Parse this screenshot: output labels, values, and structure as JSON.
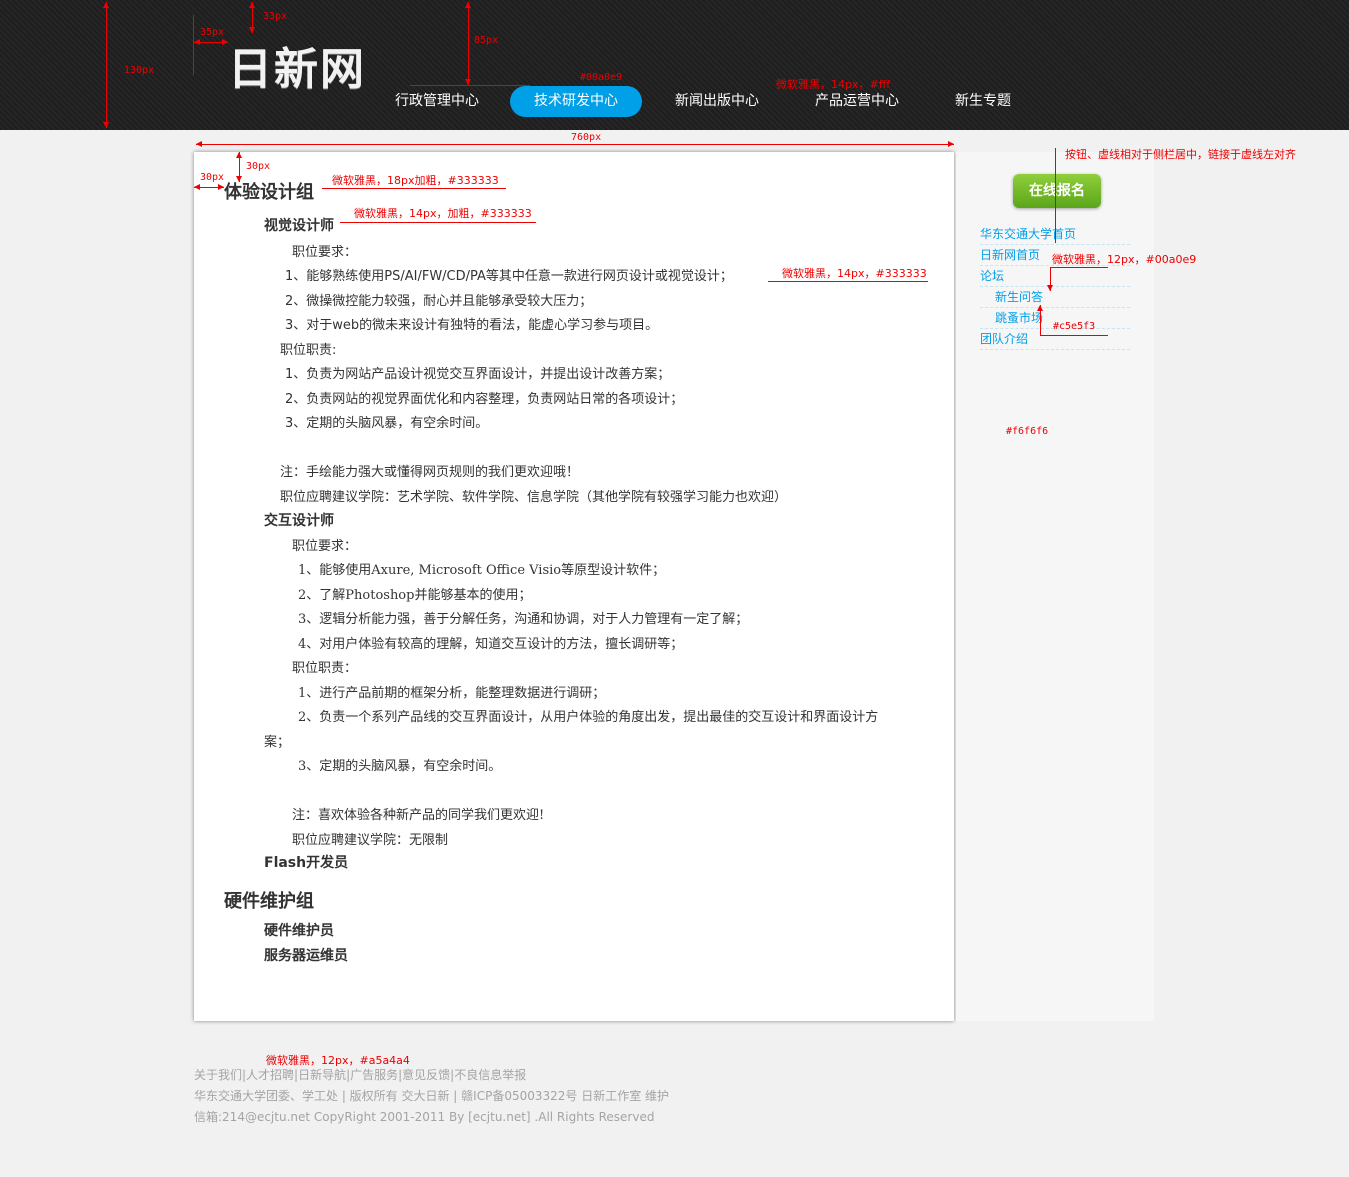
{
  "header": {
    "logo": "日新网",
    "nav": [
      {
        "label": "行政管理中心",
        "active": false
      },
      {
        "label": "技术研发中心",
        "active": true
      },
      {
        "label": "新闻出版中心",
        "active": false
      },
      {
        "label": "产品运营中心",
        "active": false
      },
      {
        "label": "新生专题",
        "active": false
      }
    ]
  },
  "main": {
    "group1_title": "体验设计组",
    "visual": {
      "title": "视觉设计师",
      "req_label": "职位要求：",
      "req": [
        "1、能够熟练使用PS/AI/FW/CD/PA等其中任意一款进行网页设计或视觉设计；",
        "2、微操微控能力较强，耐心并且能够承受较大压力；",
        "3、对于web的微未来设计有独特的看法，能虚心学习参与项目。"
      ],
      "duty_label": "职位职责:",
      "duty": [
        "1、负责为网站产品设计视觉交互界面设计，并提出设计改善方案；",
        "2、负责网站的视觉界面优化和内容整理，负责网站日常的各项设计；",
        "3、定期的头脑风暴，有空余时间。"
      ],
      "note": "注：手绘能力强大或懂得网页规则的我们更欢迎哦！",
      "college": "职位应聘建议学院：艺术学院、软件学院、信息学院（其他学院有较强学习能力也欢迎）"
    },
    "interaction": {
      "title": "交互设计师",
      "req_label": "职位要求：",
      "req": [
        "1、能够使用Axure, Microsoft Office Visio等原型设计软件；",
        "2、了解Photoshop并能够基本的使用；",
        "3、逻辑分析能力强，善于分解任务，沟通和协调，对于人力管理有一定了解；",
        "4、对用户体验有较高的理解，知道交互设计的方法，擅长调研等；"
      ],
      "duty_label": "职位职责：",
      "duty": [
        "1、进行产品前期的框架分析，能整理数据进行调研；",
        "2、负责一个系列产品线的交互界面设计，从用户体验的角度出发，提出最佳的交互设计和界面设计方",
        "案；",
        "3、定期的头脑风暴，有空余时间。"
      ],
      "note": "注：喜欢体验各种新产品的同学我们更欢迎!",
      "college": "职位应聘建议学院：无限制"
    },
    "flash_title": "Flash开发员",
    "group2_title": "硬件维护组",
    "hw1": "硬件维护员",
    "hw2": "服务器运维员"
  },
  "sidebar": {
    "apply_button": "在线报名",
    "links": [
      "华东交通大学首页",
      "日新网首页",
      "论坛",
      "新生问答",
      "跳蚤市场",
      "团队介绍"
    ]
  },
  "footer": {
    "links": "关于我们|人才招聘|日新导航|广告服务|意见反馈|不良信息举报",
    "line2": "华东交通大学团委、学工处 | 版权所有 交大日新 | 赣ICP备05003322号 日新工作室 维护",
    "line3": "信箱:214@ecjtu.net CopyRight 2001-2011 By [ecjtu.net] .All Rights Reserved"
  },
  "annotations": {
    "a130": "130px",
    "a35": "35px",
    "a33": "33px",
    "a85": "85px",
    "nav_color": "#00a0e9",
    "nav_font": "微软雅黑，14px，#fff",
    "a760": "760px",
    "a30a": "30px",
    "a30b": "30px",
    "group_font": "微软雅黑，18px加粗，#333333",
    "role_font": "微软雅黑，14px，加粗，#333333",
    "text_font": "微软雅黑，14px，#333333",
    "sidebar_note": "按钮、虚线相对于侧栏居中，链接于虚线左对齐",
    "link_font": "微软雅黑，12px，#00a0e9",
    "dash_color": "#c5e5f3",
    "sidebar_bg": "#f6f6f6",
    "footer_font": "微软雅黑，12px，#a5a4a4"
  }
}
